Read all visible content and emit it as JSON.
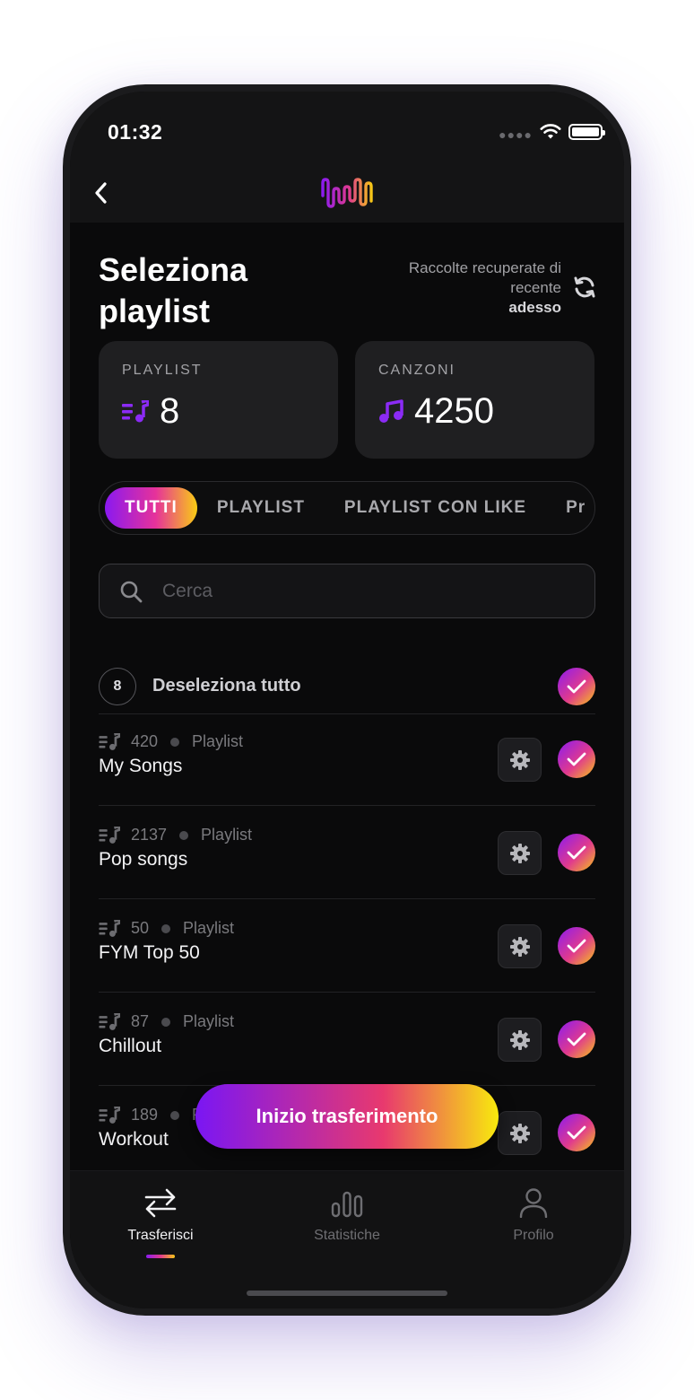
{
  "status_bar": {
    "time": "01:32"
  },
  "header": {
    "logo": "waveform-logo",
    "back_icon": "chevron-left-icon"
  },
  "page": {
    "title": "Seleziona playlist",
    "recent_text": "Raccolte recuperate di recente",
    "recent_when": "adesso"
  },
  "stats": {
    "playlist": {
      "label": "PLAYLIST",
      "value": "8",
      "icon": "playlist-icon"
    },
    "songs": {
      "label": "CANZONI",
      "value": "4250",
      "icon": "music-note-icon"
    }
  },
  "tabs": [
    {
      "label": "TUTTI",
      "active": true
    },
    {
      "label": "PLAYLIST",
      "active": false
    },
    {
      "label": "PLAYLIST CON LIKE",
      "active": false
    },
    {
      "label": "Pr",
      "active": false
    }
  ],
  "search": {
    "placeholder": "Cerca"
  },
  "select_all": {
    "count": "8",
    "label": "Deseleziona tutto",
    "checked": true
  },
  "playlists": [
    {
      "count": "420",
      "type": "Playlist",
      "name": "My Songs",
      "checked": true
    },
    {
      "count": "2137",
      "type": "Playlist",
      "name": "Pop songs",
      "checked": true
    },
    {
      "count": "50",
      "type": "Playlist",
      "name": "FYM Top 50",
      "checked": true
    },
    {
      "count": "87",
      "type": "Playlist",
      "name": "Chillout",
      "checked": true
    },
    {
      "count": "189",
      "type": "P",
      "name": "Workout",
      "checked": true
    }
  ],
  "cta": {
    "label": "Inizio trasferimento"
  },
  "bottom_nav": [
    {
      "label": "Trasferisci",
      "icon": "transfer-icon",
      "active": true
    },
    {
      "label": "Statistiche",
      "icon": "stats-icon",
      "active": false
    },
    {
      "label": "Profilo",
      "icon": "profile-icon",
      "active": false
    }
  ],
  "colors": {
    "gradient_start": "#8b1bf0",
    "gradient_mid": "#e03a8e",
    "gradient_end": "#f6c617",
    "background": "#0a0a0b",
    "card": "#1f1f21"
  }
}
